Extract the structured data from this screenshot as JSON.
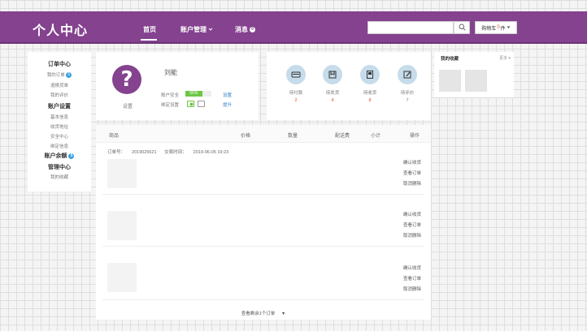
{
  "header": {
    "logo": "个人中心",
    "nav": [
      {
        "label": "首页"
      },
      {
        "label": "账户管理"
      },
      {
        "label": "消息"
      }
    ],
    "msg_badge": "0",
    "search_placeholder": "",
    "cart": {
      "prefix": "购物车",
      "count": "0",
      "suffix": "件"
    }
  },
  "sidebar": {
    "order_center": "订单中心",
    "my_orders": "我的订单",
    "my_orders_badge": "5",
    "returns": "退换货单",
    "my_reviews": "我的评价",
    "account_settings": "账户设置",
    "basic_info": "基本信息",
    "shipping_address": "收货地址",
    "security_center": "安全中心",
    "bind_info": "绑定信息",
    "account_balance": "账户余额",
    "balance_badge": "5",
    "management_center": "管理中心",
    "my_favorites": "我的收藏"
  },
  "profile": {
    "avatar_glyph": "?",
    "avatar_caption": "设置",
    "name": "刘能",
    "security_label": "账户安全",
    "security_percent": "65%",
    "security_fraction": 0.65,
    "security_link": "设置",
    "bind_label": "绑定设置",
    "bind_link": "提升"
  },
  "order_status": [
    {
      "label": "待付款",
      "count": "2",
      "icon": "wallet-icon"
    },
    {
      "label": "待发货",
      "count": "4",
      "icon": "package-icon"
    },
    {
      "label": "待收货",
      "count": "8",
      "icon": "box-icon"
    },
    {
      "label": "待评价",
      "count": "7",
      "icon": "edit-icon"
    }
  ],
  "favorites": {
    "title": "我的收藏",
    "more": "更多"
  },
  "orders_table": {
    "columns": [
      "商品",
      "价格",
      "数量",
      "配送费",
      "小计",
      "操作"
    ],
    "order_no_label": "订单号：",
    "order_no": "2019025621",
    "order_time_label": "交易时间：",
    "order_time": "2019-06-05  19:23",
    "actions": [
      "确认收货",
      "查看订单",
      "取消删除"
    ],
    "load_more": "查看剩余1个订单"
  },
  "colors": {
    "brand": "#84428f",
    "accent": "#e04f2a",
    "link": "#2a7fc9",
    "success": "#6cc644"
  }
}
